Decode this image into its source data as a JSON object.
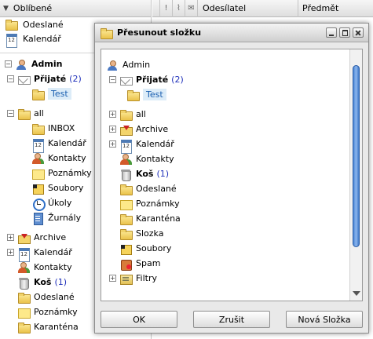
{
  "favorites": {
    "title": "Oblíbené",
    "items": [
      {
        "label": "Odeslané",
        "icon": "sent-icon"
      },
      {
        "label": "Kalendář",
        "icon": "calendar-icon"
      }
    ]
  },
  "left_tree": {
    "account": "Admin",
    "inbox": {
      "label": "Přijaté",
      "count": "(2)"
    },
    "inbox_child": "Test",
    "all": "all",
    "all_children": [
      "INBOX",
      "Kalendář",
      "Kontakty",
      "Poznámky",
      "Soubory",
      "Úkoly",
      "Žurnály"
    ],
    "archive": "Archive",
    "calendar": "Kalendář",
    "contacts": "Kontakty",
    "trash": {
      "label": "Koš",
      "count": "(1)"
    },
    "sent": "Odeslané",
    "notes": "Poznámky",
    "quarantine": "Karanténa"
  },
  "message_list": {
    "col_sender": "Odesílatel",
    "col_subject": "Předmět"
  },
  "dialog": {
    "title": "Přesunout složku",
    "tree": {
      "account": "Admin",
      "inbox": {
        "label": "Přijaté",
        "count": "(2)"
      },
      "inbox_child": "Test",
      "items": {
        "all": "all",
        "archive": "Archive",
        "calendar": "Kalendář",
        "contacts": "Kontakty",
        "trash": "Koš",
        "trash_count": "(1)",
        "sent": "Odeslané",
        "notes": "Poznámky",
        "quarantine": "Karanténa",
        "slozka": "Slozka",
        "files": "Soubory",
        "spam": "Spam",
        "filters": "Filtry"
      }
    },
    "buttons": {
      "ok": "OK",
      "cancel": "Zrušit",
      "new_folder": "Nová Složka"
    }
  }
}
